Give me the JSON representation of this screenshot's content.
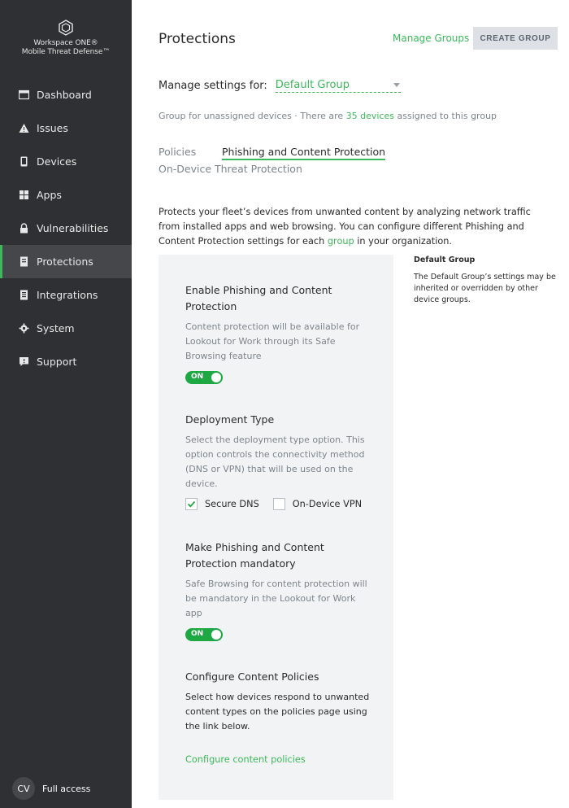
{
  "brand": {
    "line1": "Workspace ONE®",
    "line2": "Mobile Threat Defense™",
    "accent_color": "#3db85b"
  },
  "sidebar": {
    "items": [
      {
        "label": "Dashboard",
        "icon": "dashboard-icon"
      },
      {
        "label": "Issues",
        "icon": "warning-icon"
      },
      {
        "label": "Devices",
        "icon": "device-icon"
      },
      {
        "label": "Apps",
        "icon": "apps-grid-icon"
      },
      {
        "label": "Vulnerabilities",
        "icon": "lock-icon"
      },
      {
        "label": "Protections",
        "icon": "protection-icon",
        "active": true
      },
      {
        "label": "Integrations",
        "icon": "integrations-icon"
      },
      {
        "label": "System",
        "icon": "gear-icon"
      },
      {
        "label": "Support",
        "icon": "support-chat-icon"
      }
    ],
    "user": {
      "initials": "CV",
      "access": "Full access"
    }
  },
  "header": {
    "title": "Protections",
    "manage_groups": "Manage Groups",
    "create_group": "CREATE GROUP"
  },
  "settings": {
    "label": "Manage settings for:",
    "selected_group": "Default Group",
    "info_prefix": "Group for unassigned devices · There are ",
    "device_count": "35 devices",
    "info_suffix": " assigned to this group"
  },
  "tabs": [
    {
      "label": "Policies",
      "active": false
    },
    {
      "label": "Phishing and Content Protection",
      "active": true
    },
    {
      "label": "On-Device Threat Protection",
      "active": false
    }
  ],
  "intro": {
    "text_before": "Protects your fleet’s devices from unwanted content by analyzing network traffic from installed apps and web browsing. You can configure different Phishing and Content Protection settings for each ",
    "link": "group",
    "text_after": " in your organization."
  },
  "sections": {
    "enable": {
      "title": "Enable Phishing and Content Protection",
      "desc": "Content protection will be available for Lookout for Work through its Safe Browsing feature",
      "toggle": "ON"
    },
    "deployment": {
      "title": "Deployment Type",
      "desc": "Select the deployment type option. This option controls the connectivity method (DNS or VPN) that will be used on the device.",
      "options": [
        {
          "label": "Secure DNS",
          "checked": true
        },
        {
          "label": "On-Device VPN",
          "checked": false
        }
      ]
    },
    "mandatory": {
      "title": "Make Phishing and Content Protection mandatory",
      "desc": "Safe Browsing for content protection will be mandatory in the Lookout for Work app",
      "toggle": "ON"
    },
    "policies": {
      "title": "Configure Content Policies",
      "desc": "Select how devices respond to unwanted content types on the policies page using the link below.",
      "link": "Configure content policies"
    }
  },
  "side_note": {
    "title": "Default Group",
    "text": "The Default Group’s settings may be inherited or overridden by other device groups."
  }
}
